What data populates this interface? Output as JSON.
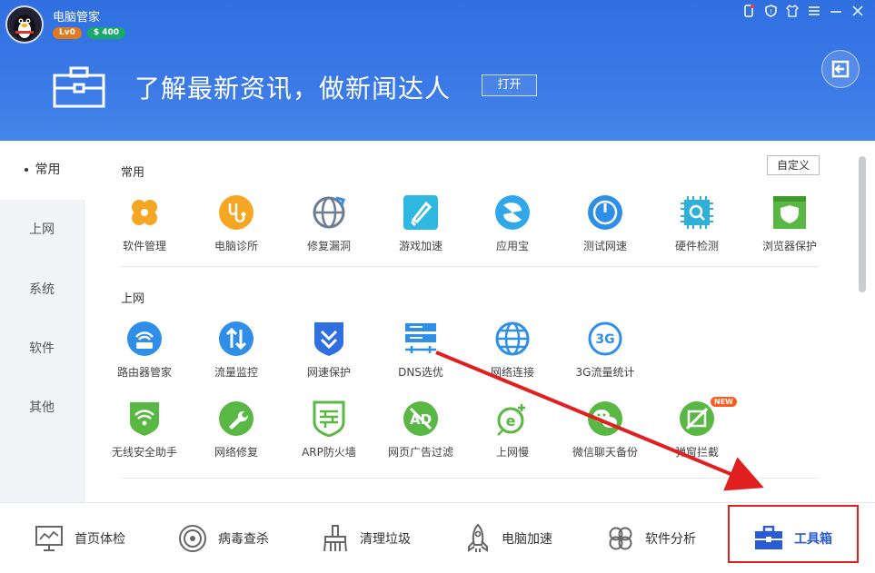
{
  "titlebar": {
    "app_name": "电脑管家",
    "level_badge": "Lv0",
    "money_badge": "$ 400",
    "window_controls": [
      "phone-icon",
      "shield-icon",
      "shirt-icon",
      "menu-icon",
      "minimize-icon",
      "close-icon"
    ]
  },
  "banner": {
    "text": "了解最新资讯，做新闻达人",
    "button_label": "打开"
  },
  "sidebar": {
    "items": [
      {
        "label": "常用",
        "active": true
      },
      {
        "label": "上网",
        "active": false
      },
      {
        "label": "系统",
        "active": false
      },
      {
        "label": "软件",
        "active": false
      },
      {
        "label": "其他",
        "active": false
      }
    ]
  },
  "content": {
    "custom_button": "自定义",
    "sections": [
      {
        "title": "常用",
        "tools": [
          {
            "label": "软件管理",
            "icon": "clover-icon",
            "color": "#f5a623"
          },
          {
            "label": "电脑诊所",
            "icon": "stethoscope-icon",
            "color": "#f5a623"
          },
          {
            "label": "修复漏洞",
            "icon": "globe-repair-icon",
            "color": "#6b7c93"
          },
          {
            "label": "游戏加速",
            "icon": "rocket-icon",
            "color": "#2fb8e0"
          },
          {
            "label": "应用宝",
            "icon": "appbao-icon",
            "color": "#2fa7e8"
          },
          {
            "label": "测试网速",
            "icon": "speed-gauge-icon",
            "color": "#2f8ee8"
          },
          {
            "label": "硬件检测",
            "icon": "chip-icon",
            "color": "#2fb0d8"
          },
          {
            "label": "浏览器保护",
            "icon": "browser-shield-icon",
            "color": "#59b843"
          }
        ]
      },
      {
        "title": "上网",
        "tools": [
          {
            "label": "路由器管家",
            "icon": "router-icon",
            "color": "#2f8ee8"
          },
          {
            "label": "流量监控",
            "icon": "traffic-arrows-icon",
            "color": "#2f8ee8"
          },
          {
            "label": "网速保护",
            "icon": "shield-chevron-icon",
            "color": "#2f6fe0"
          },
          {
            "label": "DNS选优",
            "icon": "server-icon",
            "color": "#2f8ee8"
          },
          {
            "label": "网络连接",
            "icon": "globe-icon",
            "color": "#2f8ee8"
          },
          {
            "label": "3G流量统计",
            "icon": "3g-icon",
            "color": "#2f8ee8"
          },
          {
            "label": "无线安全助手",
            "icon": "wifi-shield-icon",
            "color": "#59b843"
          },
          {
            "label": "网络修复",
            "icon": "wrench-icon",
            "color": "#59b843"
          },
          {
            "label": "ARP防火墙",
            "icon": "firewall-icon",
            "color": "#59b843"
          },
          {
            "label": "网页广告过滤",
            "icon": "ad-block-icon",
            "color": "#59b843"
          },
          {
            "label": "上网慢",
            "icon": "ie-slow-icon",
            "color": "#59b843"
          },
          {
            "label": "微信聊天备份",
            "icon": "wechat-icon",
            "color": "#59b843"
          },
          {
            "label": "弹窗拦截",
            "icon": "popup-block-icon",
            "color": "#59b843",
            "badge": "NEW"
          }
        ]
      }
    ]
  },
  "bottom_nav": {
    "items": [
      {
        "label": "首页体检",
        "icon": "monitor-chart-icon",
        "active": false
      },
      {
        "label": "病毒查杀",
        "icon": "target-icon",
        "active": false
      },
      {
        "label": "清理垃圾",
        "icon": "broom-icon",
        "active": false
      },
      {
        "label": "电脑加速",
        "icon": "rocket-icon",
        "active": false
      },
      {
        "label": "软件分析",
        "icon": "clover-icon",
        "active": false
      },
      {
        "label": "工具箱",
        "icon": "toolbox-icon",
        "active": true
      }
    ]
  },
  "colors": {
    "header_blue": "#3b7ae6",
    "active_blue": "#2a5bd7",
    "highlight_red": "#e02020"
  }
}
